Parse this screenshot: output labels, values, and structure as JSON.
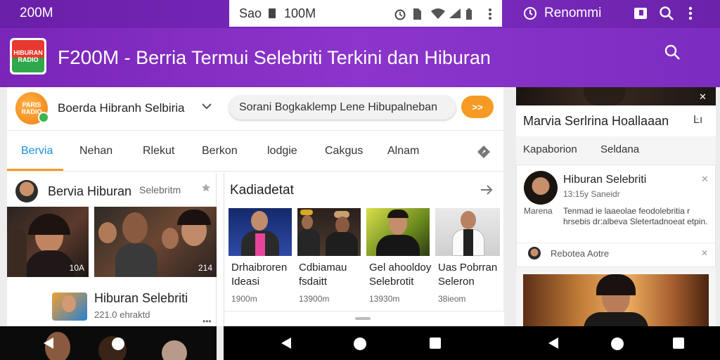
{
  "status_bar": {
    "left_text": "200M",
    "center_text": "Sao",
    "center_value": "100M",
    "right_text": "Renommi",
    "icons": [
      "alarm-icon",
      "sim-icon",
      "wifi-icon",
      "signal-icon",
      "battery-icon",
      "more-vert-icon",
      "clock-icon",
      "gallery-icon",
      "search-icon",
      "more-vert-icon"
    ]
  },
  "app_header": {
    "brand": "F200M",
    "title": " - Berria Termui Selebriti Terkini dan Hiburan",
    "logo_text": "HIBURAN RADIO"
  },
  "topic": {
    "avatar_text": "PARIS RADIO",
    "label": "Boerda Hibranh Selbiria"
  },
  "search": {
    "placeholder": "Sorani Bogkaklemp Lene  Hibupalneban",
    "go_label": ">>"
  },
  "tabs": [
    "Bervia",
    "Nehan",
    "Rlekut",
    "Berkon",
    "lodgie",
    "Cakgus",
    "Alnam"
  ],
  "card_left": {
    "title": "Bervia Hiburan",
    "subtitle": "Selebritm",
    "photo_counts": [
      "10A",
      "214"
    ],
    "item_title": "Hiburan Selebriti",
    "item_meta": "221.0 ehraktd"
  },
  "card_right": {
    "title": "Kadiadetat",
    "items": [
      {
        "line1": "Drhaibroren",
        "line2": "Ideasi",
        "meta": "1900m"
      },
      {
        "line1": "Cdbiamau",
        "line2": "fsdaitt",
        "meta": "13900m"
      },
      {
        "line1": "Gel ahooldoy",
        "line2": "Selebrotit",
        "meta": "13930m"
      },
      {
        "line1": "Uas Pobrran",
        "line2": "Seleron",
        "meta": "38ieom"
      }
    ]
  },
  "right_panel": {
    "title": "Marvia Serlrina Hoallaaan",
    "tabs": [
      "Kapaborion",
      "Seldana"
    ],
    "notif_title": "Hiburan Selebriti",
    "notif_time": "13:15y Saneidr",
    "notif_label": "Marena",
    "notif_body": "Tenmad ie laaeolae feodolebritia r hrsebis dr:albeva Sletertadnoeat etpin.",
    "notif_footer": "Rebotea Aotre"
  },
  "colors": {
    "header_purple": "#8c35cc",
    "status_purple": "#6a1fa8",
    "accent_orange": "#f59b23",
    "tab_blue": "#1a8ee0"
  }
}
